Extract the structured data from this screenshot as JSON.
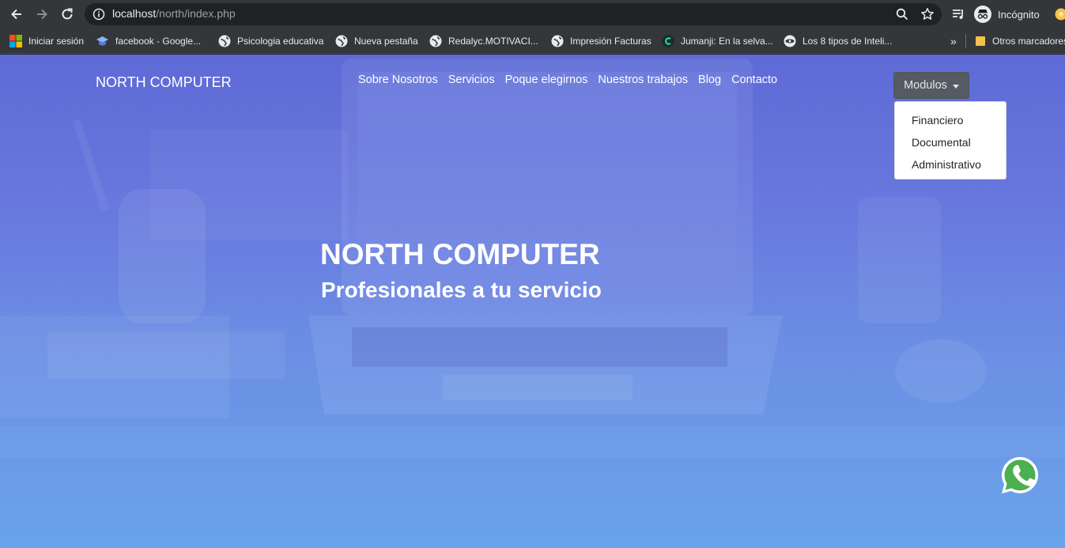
{
  "browser": {
    "url_host": "localhost",
    "url_path": "/north/index.php",
    "profile_label": "Incógnito"
  },
  "bookmarks": [
    {
      "label": "Iniciar sesión",
      "icon": "microsoft-icon"
    },
    {
      "label": "facebook - Google...",
      "icon": "graduation-cap-icon"
    },
    {
      "label": "Psicologia educativa",
      "icon": "globe-icon"
    },
    {
      "label": "Nueva pestaña",
      "icon": "globe-icon"
    },
    {
      "label": "Redalyc.MOTIVACI...",
      "icon": "globe-icon"
    },
    {
      "label": "Impresión Facturas",
      "icon": "globe-icon"
    },
    {
      "label": "Jumanji: En la selva...",
      "icon": "c-logo-icon"
    },
    {
      "label": "Los 8 tipos de Inteli...",
      "icon": "site-icon"
    }
  ],
  "bookmarks_overflow": "»",
  "other_bookmarks": "Otros marcadores",
  "site": {
    "brand": "NORTH COMPUTER",
    "nav": [
      "Sobre Nosotros",
      "Servicios",
      "Poque elegirnos",
      "Nuestros trabajos",
      "Blog",
      "Contacto"
    ],
    "dropdown_label": "Modulos",
    "dropdown_items": [
      "Financiero",
      "Documental",
      "Administrativo"
    ],
    "hero_title": "NORTH COMPUTER",
    "hero_subtitle": "Profesionales a tu servicio"
  },
  "colors": {
    "hero_top": "#5e6ad6",
    "hero_bottom": "#69a4ea",
    "dropdown_button": "#545b62",
    "whatsapp": "#4caf50"
  }
}
